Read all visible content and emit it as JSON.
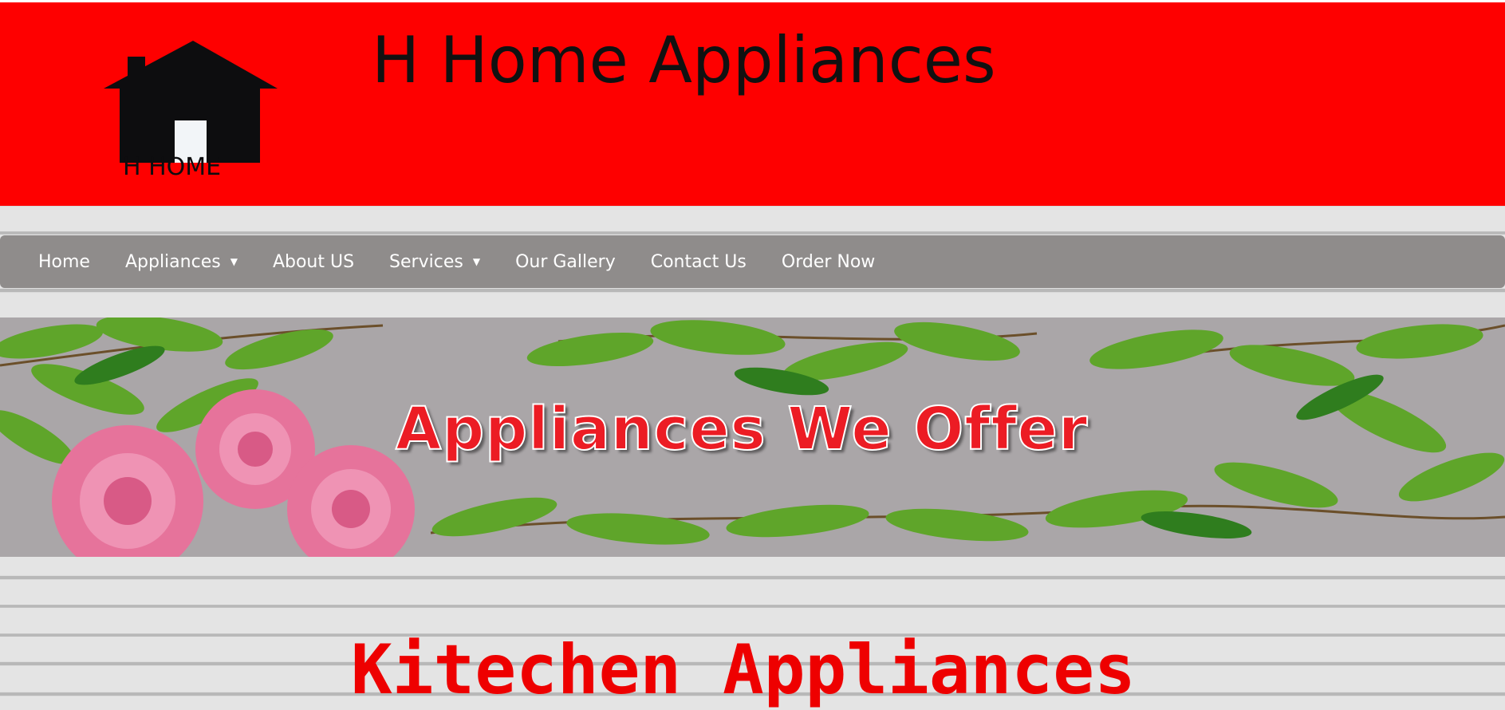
{
  "header": {
    "title": "H Home Appliances",
    "logo_text": "H HOME",
    "background_color": "#fe0000"
  },
  "nav": {
    "items": [
      {
        "label": "Home",
        "has_dropdown": false
      },
      {
        "label": "Appliances",
        "has_dropdown": true
      },
      {
        "label": "About US",
        "has_dropdown": false
      },
      {
        "label": "Services",
        "has_dropdown": true
      },
      {
        "label": "Our Gallery",
        "has_dropdown": false
      },
      {
        "label": "Contact Us",
        "has_dropdown": false
      },
      {
        "label": "Order Now",
        "has_dropdown": false
      }
    ],
    "caret": "▼"
  },
  "banner": {
    "text": "Appliances We Offer"
  },
  "main": {
    "section_title": "Kitechen Appliances"
  }
}
